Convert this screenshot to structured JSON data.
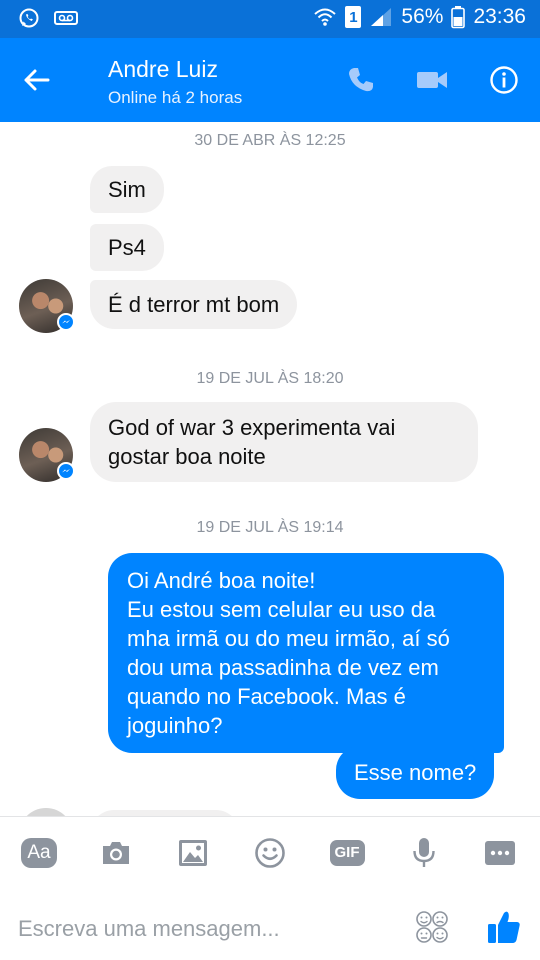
{
  "status_bar": {
    "battery": "56%",
    "time": "23:36",
    "sim_slot": "1",
    "icons": [
      "whatsapp-icon",
      "voicemail-icon",
      "wifi-icon",
      "signal-icon",
      "battery-icon"
    ]
  },
  "header": {
    "contact_name": "Andre Luiz",
    "contact_status": "Online há 2 horas",
    "icons": [
      "back-arrow-icon",
      "phone-icon",
      "video-camera-icon",
      "info-icon"
    ]
  },
  "conversation": {
    "groups": [
      {
        "timestamp": "30 DE ABR ÀS 12:25",
        "messages": [
          {
            "direction": "in",
            "text": "Sim"
          },
          {
            "direction": "in",
            "text": "Ps4"
          },
          {
            "direction": "in",
            "text": "É d terror mt bom"
          }
        ]
      },
      {
        "timestamp": "19 DE JUL ÀS 18:20",
        "messages": [
          {
            "direction": "in",
            "text_lines": [
              "God of war 3 experimenta vai",
              "gostar boa noite"
            ]
          }
        ]
      },
      {
        "timestamp": "19 DE JUL ÀS 19:14",
        "messages": [
          {
            "direction": "out",
            "text_lines": [
              "Oi André boa noite!",
              "Eu estou sem celular eu uso da",
              "mha irmã ou do meu irmão, aí só",
              "dou uma passadinha de vez em",
              "quando no Facebook. Mas é",
              "joguinho?"
            ]
          },
          {
            "direction": "out",
            "text": "Esse nome?"
          }
        ]
      }
    ]
  },
  "composer": {
    "tools": [
      {
        "name": "text-style-button",
        "label": "Aa"
      },
      {
        "name": "camera-button",
        "icon": "camera-icon"
      },
      {
        "name": "gallery-button",
        "icon": "image-icon"
      },
      {
        "name": "emoji-button",
        "icon": "smiley-icon"
      },
      {
        "name": "gif-button",
        "label": "GIF"
      },
      {
        "name": "microphone-button",
        "icon": "microphone-icon"
      },
      {
        "name": "more-button",
        "icon": "more-icon"
      }
    ],
    "placeholder": "Escreva uma mensagem...",
    "icons": [
      "stickers-icon",
      "like-thumb-icon"
    ]
  },
  "colors": {
    "status_bar": "#0a71d8",
    "header": "#0084ff",
    "outgoing_bubble": "#0084ff",
    "incoming_bubble": "#f1f0f0",
    "timestamp_text": "#8d949e",
    "toolbar_icon": "#8d949e"
  }
}
